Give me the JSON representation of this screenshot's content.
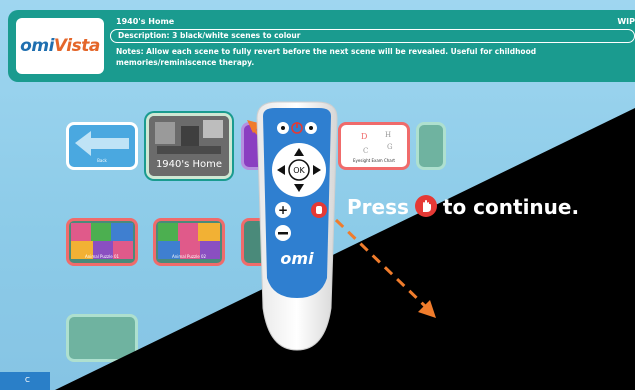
{
  "header": {
    "logo_text_a": "omi",
    "logo_text_b": "Vista",
    "title": "1940's Home",
    "wip_label": "WIP",
    "description": "Description: 3 black/white scenes to colour",
    "notes": "Notes: Allow each scene to fully revert before the next scene will be revealed. Useful for childhood memories/reminiscence therapy."
  },
  "tiles": {
    "back": "Back",
    "home": "1940's Home",
    "eye_chart": "Eyesight Exam Chart",
    "puzzle_1": "Animal Puzzle 01",
    "puzzle_2": "Animal Puzzle 02"
  },
  "overlay": {
    "press_text_a": "Press",
    "press_text_b": "to continue."
  },
  "remote": {
    "ok_label": "OK",
    "brand": "omi"
  },
  "colors": {
    "header_bg": "#1a9b8f",
    "page_bg": "#8ecbe8",
    "arrow": "#f07c2c",
    "stop": "#e53935"
  },
  "footer": {
    "label": "C"
  }
}
